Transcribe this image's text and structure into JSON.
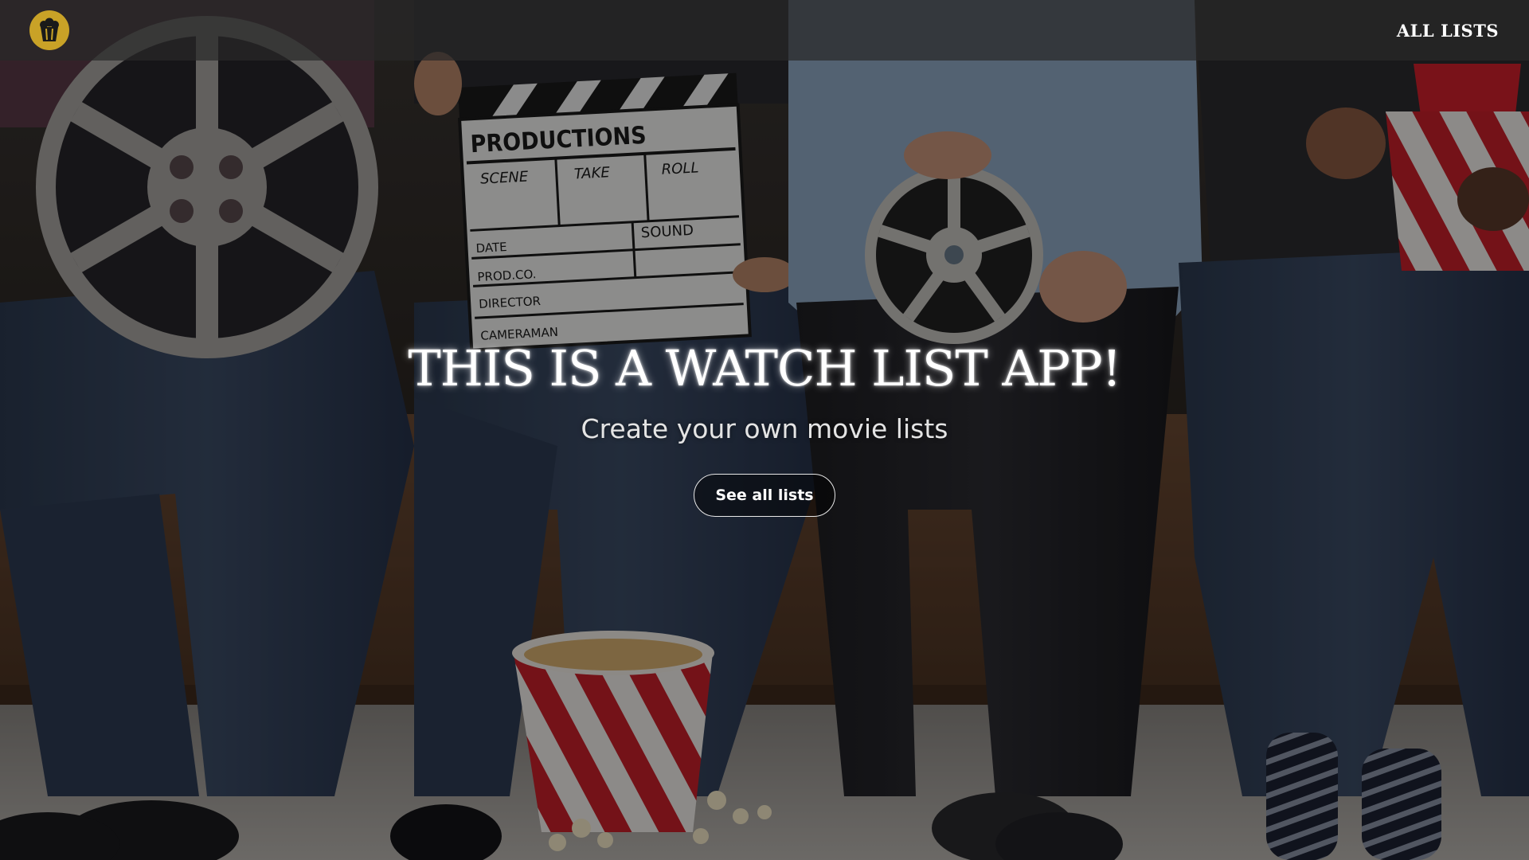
{
  "nav": {
    "logo_icon": "popcorn-icon",
    "all_lists_label": "ALL LISTS"
  },
  "hero": {
    "title": "THIS IS A WATCH LIST APP!",
    "subtitle": "Create your own movie lists",
    "cta_label": "See all lists"
  },
  "background_scene": {
    "clapperboard": {
      "heading": "PRODUCTIONS",
      "scene": "SCENE",
      "take": "TAKE",
      "roll": "ROLL",
      "date": "DATE",
      "sound": "SOUND",
      "prod_co": "PROD.CO.",
      "director": "DIRECTOR",
      "cameraman": "CAMERAMAN"
    }
  },
  "colors": {
    "logo_gold": "#c9a227",
    "navbar_bg": "#282828",
    "text_white": "#ffffff",
    "popcorn_red": "#c8202a"
  }
}
